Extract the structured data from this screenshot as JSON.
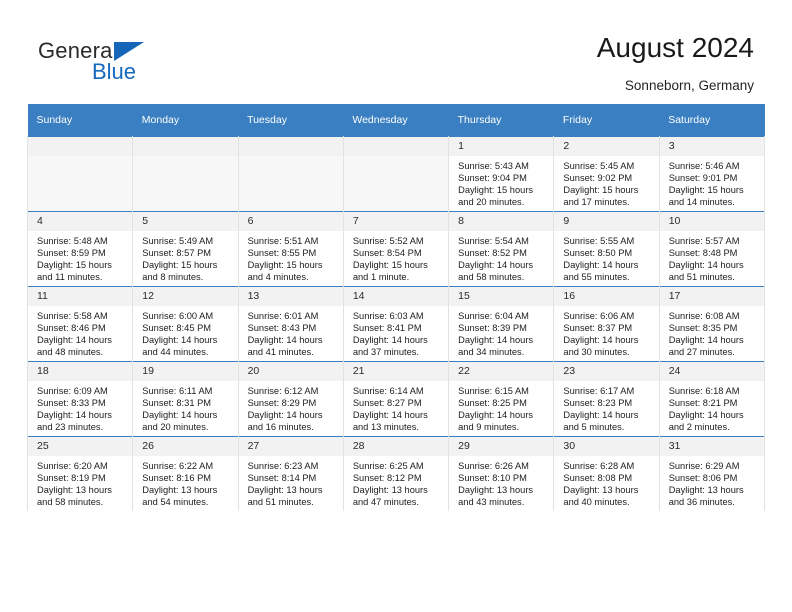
{
  "brand": {
    "name_part1": "General",
    "name_part2": "Blue",
    "triangle_color": "#1565b8",
    "blue_text_color": "#1668bd"
  },
  "header": {
    "title": "August 2024",
    "subtitle": "Sonneborn, Germany"
  },
  "theme": {
    "header_row_bg": "#3a7fc1",
    "header_row_text": "#ffffff",
    "row_top_border": "#3a7fc1",
    "daynum_bg": "#f2f2f2",
    "empty_cell_bg": "#f7f7f7",
    "cell_border": "#e2e2e2"
  },
  "weekdays": [
    "Sunday",
    "Monday",
    "Tuesday",
    "Wednesday",
    "Thursday",
    "Friday",
    "Saturday"
  ],
  "weeks": [
    [
      {
        "day": "",
        "lines": []
      },
      {
        "day": "",
        "lines": []
      },
      {
        "day": "",
        "lines": []
      },
      {
        "day": "",
        "lines": []
      },
      {
        "day": "1",
        "lines": [
          "Sunrise: 5:43 AM",
          "Sunset: 9:04 PM",
          "Daylight: 15 hours",
          "and 20 minutes."
        ]
      },
      {
        "day": "2",
        "lines": [
          "Sunrise: 5:45 AM",
          "Sunset: 9:02 PM",
          "Daylight: 15 hours",
          "and 17 minutes."
        ]
      },
      {
        "day": "3",
        "lines": [
          "Sunrise: 5:46 AM",
          "Sunset: 9:01 PM",
          "Daylight: 15 hours",
          "and 14 minutes."
        ]
      }
    ],
    [
      {
        "day": "4",
        "lines": [
          "Sunrise: 5:48 AM",
          "Sunset: 8:59 PM",
          "Daylight: 15 hours",
          "and 11 minutes."
        ]
      },
      {
        "day": "5",
        "lines": [
          "Sunrise: 5:49 AM",
          "Sunset: 8:57 PM",
          "Daylight: 15 hours",
          "and 8 minutes."
        ]
      },
      {
        "day": "6",
        "lines": [
          "Sunrise: 5:51 AM",
          "Sunset: 8:55 PM",
          "Daylight: 15 hours",
          "and 4 minutes."
        ]
      },
      {
        "day": "7",
        "lines": [
          "Sunrise: 5:52 AM",
          "Sunset: 8:54 PM",
          "Daylight: 15 hours",
          "and 1 minute."
        ]
      },
      {
        "day": "8",
        "lines": [
          "Sunrise: 5:54 AM",
          "Sunset: 8:52 PM",
          "Daylight: 14 hours",
          "and 58 minutes."
        ]
      },
      {
        "day": "9",
        "lines": [
          "Sunrise: 5:55 AM",
          "Sunset: 8:50 PM",
          "Daylight: 14 hours",
          "and 55 minutes."
        ]
      },
      {
        "day": "10",
        "lines": [
          "Sunrise: 5:57 AM",
          "Sunset: 8:48 PM",
          "Daylight: 14 hours",
          "and 51 minutes."
        ]
      }
    ],
    [
      {
        "day": "11",
        "lines": [
          "Sunrise: 5:58 AM",
          "Sunset: 8:46 PM",
          "Daylight: 14 hours",
          "and 48 minutes."
        ]
      },
      {
        "day": "12",
        "lines": [
          "Sunrise: 6:00 AM",
          "Sunset: 8:45 PM",
          "Daylight: 14 hours",
          "and 44 minutes."
        ]
      },
      {
        "day": "13",
        "lines": [
          "Sunrise: 6:01 AM",
          "Sunset: 8:43 PM",
          "Daylight: 14 hours",
          "and 41 minutes."
        ]
      },
      {
        "day": "14",
        "lines": [
          "Sunrise: 6:03 AM",
          "Sunset: 8:41 PM",
          "Daylight: 14 hours",
          "and 37 minutes."
        ]
      },
      {
        "day": "15",
        "lines": [
          "Sunrise: 6:04 AM",
          "Sunset: 8:39 PM",
          "Daylight: 14 hours",
          "and 34 minutes."
        ]
      },
      {
        "day": "16",
        "lines": [
          "Sunrise: 6:06 AM",
          "Sunset: 8:37 PM",
          "Daylight: 14 hours",
          "and 30 minutes."
        ]
      },
      {
        "day": "17",
        "lines": [
          "Sunrise: 6:08 AM",
          "Sunset: 8:35 PM",
          "Daylight: 14 hours",
          "and 27 minutes."
        ]
      }
    ],
    [
      {
        "day": "18",
        "lines": [
          "Sunrise: 6:09 AM",
          "Sunset: 8:33 PM",
          "Daylight: 14 hours",
          "and 23 minutes."
        ]
      },
      {
        "day": "19",
        "lines": [
          "Sunrise: 6:11 AM",
          "Sunset: 8:31 PM",
          "Daylight: 14 hours",
          "and 20 minutes."
        ]
      },
      {
        "day": "20",
        "lines": [
          "Sunrise: 6:12 AM",
          "Sunset: 8:29 PM",
          "Daylight: 14 hours",
          "and 16 minutes."
        ]
      },
      {
        "day": "21",
        "lines": [
          "Sunrise: 6:14 AM",
          "Sunset: 8:27 PM",
          "Daylight: 14 hours",
          "and 13 minutes."
        ]
      },
      {
        "day": "22",
        "lines": [
          "Sunrise: 6:15 AM",
          "Sunset: 8:25 PM",
          "Daylight: 14 hours",
          "and 9 minutes."
        ]
      },
      {
        "day": "23",
        "lines": [
          "Sunrise: 6:17 AM",
          "Sunset: 8:23 PM",
          "Daylight: 14 hours",
          "and 5 minutes."
        ]
      },
      {
        "day": "24",
        "lines": [
          "Sunrise: 6:18 AM",
          "Sunset: 8:21 PM",
          "Daylight: 14 hours",
          "and 2 minutes."
        ]
      }
    ],
    [
      {
        "day": "25",
        "lines": [
          "Sunrise: 6:20 AM",
          "Sunset: 8:19 PM",
          "Daylight: 13 hours",
          "and 58 minutes."
        ]
      },
      {
        "day": "26",
        "lines": [
          "Sunrise: 6:22 AM",
          "Sunset: 8:16 PM",
          "Daylight: 13 hours",
          "and 54 minutes."
        ]
      },
      {
        "day": "27",
        "lines": [
          "Sunrise: 6:23 AM",
          "Sunset: 8:14 PM",
          "Daylight: 13 hours",
          "and 51 minutes."
        ]
      },
      {
        "day": "28",
        "lines": [
          "Sunrise: 6:25 AM",
          "Sunset: 8:12 PM",
          "Daylight: 13 hours",
          "and 47 minutes."
        ]
      },
      {
        "day": "29",
        "lines": [
          "Sunrise: 6:26 AM",
          "Sunset: 8:10 PM",
          "Daylight: 13 hours",
          "and 43 minutes."
        ]
      },
      {
        "day": "30",
        "lines": [
          "Sunrise: 6:28 AM",
          "Sunset: 8:08 PM",
          "Daylight: 13 hours",
          "and 40 minutes."
        ]
      },
      {
        "day": "31",
        "lines": [
          "Sunrise: 6:29 AM",
          "Sunset: 8:06 PM",
          "Daylight: 13 hours",
          "and 36 minutes."
        ]
      }
    ]
  ]
}
